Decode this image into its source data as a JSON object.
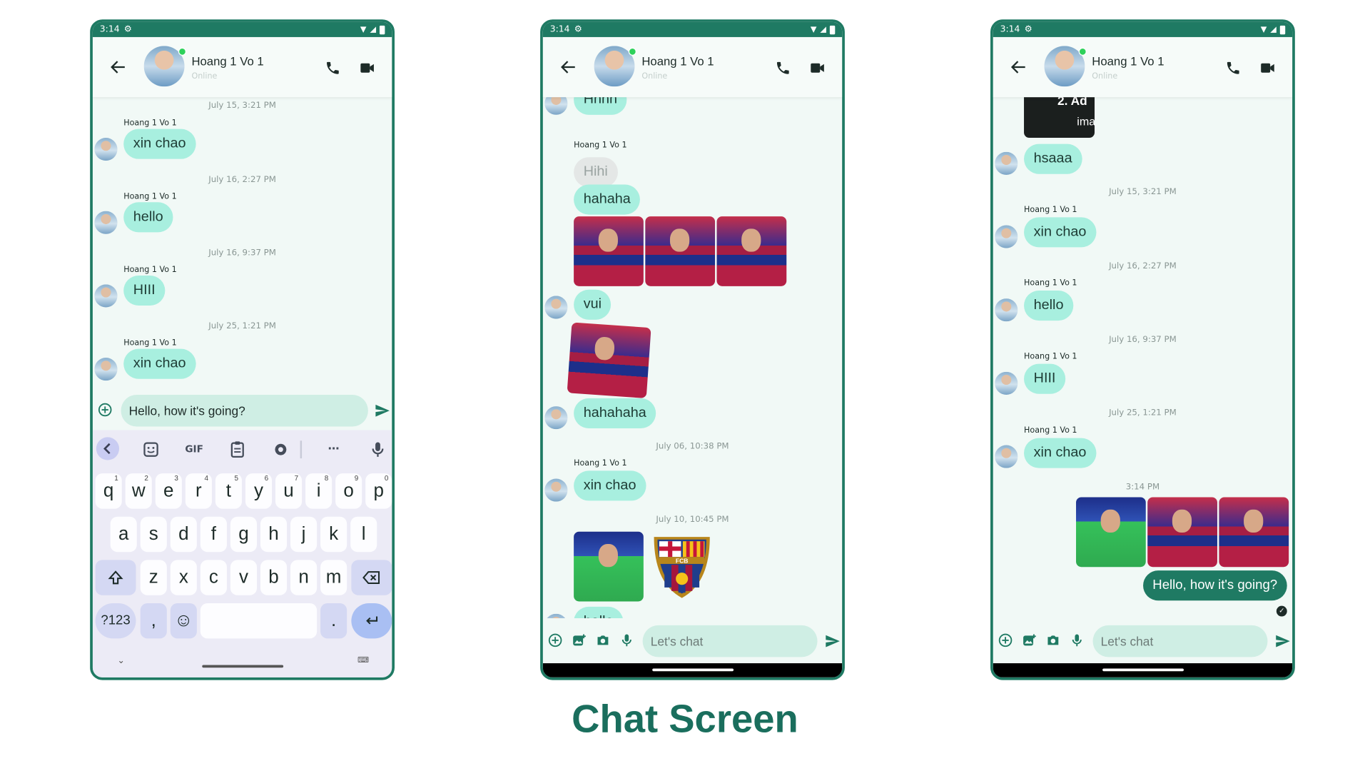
{
  "caption": "Chat Screen",
  "status_bar": {
    "time": "3:14"
  },
  "contact": {
    "name": "Hoang 1 Vo 1",
    "status": "Online"
  },
  "phone1": {
    "messages": [
      {
        "timestamp": "July 15, 3:21 PM",
        "sender": "Hoang 1 Vo 1",
        "text": "xin chao"
      },
      {
        "timestamp": "July 16, 2:27 PM",
        "sender": "Hoang 1 Vo 1",
        "text": "hello"
      },
      {
        "timestamp": "July 16, 9:37 PM",
        "sender": "Hoang 1 Vo 1",
        "text": "HIII"
      },
      {
        "timestamp": "July 25, 1:21 PM",
        "sender": "Hoang 1 Vo 1",
        "text": "xin chao"
      }
    ],
    "input_value": "Hello, how it's going?",
    "keyboard": {
      "toolbar": [
        "GIF"
      ],
      "row1": [
        [
          "q",
          "1"
        ],
        [
          "w",
          "2"
        ],
        [
          "e",
          "3"
        ],
        [
          "r",
          "4"
        ],
        [
          "t",
          "5"
        ],
        [
          "y",
          "6"
        ],
        [
          "u",
          "7"
        ],
        [
          "i",
          "8"
        ],
        [
          "o",
          "9"
        ],
        [
          "p",
          "0"
        ]
      ],
      "row2": [
        "a",
        "s",
        "d",
        "f",
        "g",
        "h",
        "j",
        "k",
        "l"
      ],
      "row3": [
        "z",
        "x",
        "c",
        "v",
        "b",
        "n",
        "m"
      ],
      "symbols_key": "?123",
      "comma_key": ",",
      "period_key": "."
    }
  },
  "phone2": {
    "top_partial": "Hhhh",
    "sender1": "Hoang 1 Vo 1",
    "grey_msg": "Hihi",
    "msg_hahaha": "hahaha",
    "msg_vui": "vui",
    "msg_hahahaha": "hahahaha",
    "timestamp1": "July 06, 10:38 PM",
    "sender2": "Hoang 1 Vo 1",
    "msg_xinchao": "xin chao",
    "timestamp2": "July 10, 10:45 PM",
    "crest_text": "FCB",
    "bottom_partial": "hallo",
    "input_placeholder": "Let's chat"
  },
  "phone3": {
    "card_line1": "2.  Ad",
    "card_line2": "ima",
    "msg_hsaaa": "hsaaa",
    "messages": [
      {
        "timestamp": "July 15, 3:21 PM",
        "sender": "Hoang 1 Vo 1",
        "text": "xin chao"
      },
      {
        "timestamp": "July 16, 2:27 PM",
        "sender": "Hoang 1 Vo 1",
        "text": "hello"
      },
      {
        "timestamp": "July 16, 9:37 PM",
        "sender": "Hoang 1 Vo 1",
        "text": "HIII"
      },
      {
        "timestamp": "July 25, 1:21 PM",
        "sender": "Hoang 1 Vo 1",
        "text": "xin chao"
      }
    ],
    "timestamp_sent": "3:14 PM",
    "msg_sent": "Hello, how it's going?",
    "input_placeholder": "Let's chat"
  },
  "icons": {
    "back": "arrow-left-icon",
    "call": "phone-icon",
    "video": "video-camera-icon",
    "send": "send-icon",
    "add": "plus-circle-icon",
    "gallery": "gallery-icon",
    "camera": "camera-icon",
    "mic": "microphone-icon"
  },
  "colors": {
    "primary": "#1f7a63",
    "bubble": "#a8efdf",
    "background": "#f1f9f6",
    "online": "#2ed15b"
  }
}
